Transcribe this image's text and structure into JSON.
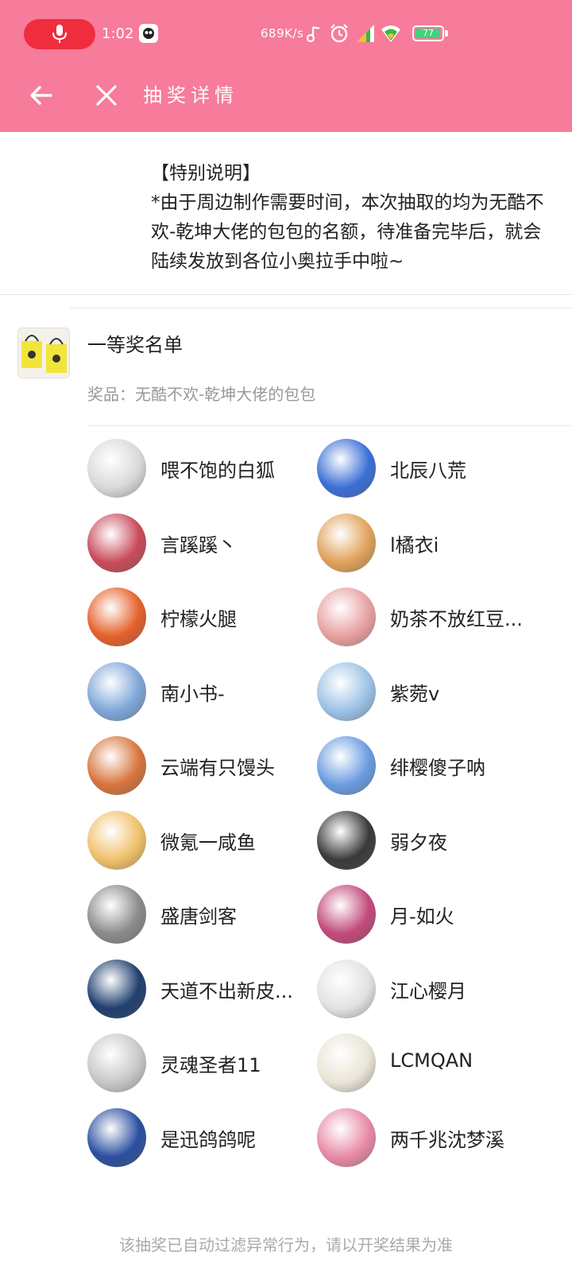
{
  "status_bar": {
    "time": "1:02",
    "net_speed": "689K/s",
    "battery": "77",
    "icons": [
      "mic-icon",
      "app-notification-icon",
      "music-icon",
      "alarm-icon",
      "signal-icon",
      "wifi-icon",
      "battery-icon"
    ]
  },
  "header": {
    "title": "抽奖详情",
    "back_icon": "arrow-left-icon",
    "close_icon": "close-icon"
  },
  "note": {
    "heading": "【特别说明】",
    "body": "*由于周边制作需要时间，本次抽取的均为无酷不欢-乾坤大佬的包包的名额，待准备完毕后，就会陆续发放到各位小奥拉手中啦~"
  },
  "prize": {
    "title": "一等奖名单",
    "label": "奖品：",
    "item": "无酷不欢-乾坤大佬的包包"
  },
  "winners": [
    {
      "name": "喂不饱的白狐",
      "color": "#d9d9d9"
    },
    {
      "name": "北辰八荒",
      "color": "#3b6fd6"
    },
    {
      "name": "言蹊蹊丶",
      "color": "#c94b5a"
    },
    {
      "name": "l橘衣i",
      "color": "#e0a25a"
    },
    {
      "name": "柠檬火腿",
      "color": "#e5602a"
    },
    {
      "name": "奶茶不放红豆...",
      "color": "#e8a0a0"
    },
    {
      "name": "南小书-",
      "color": "#7ea6d8"
    },
    {
      "name": "紫菀v",
      "color": "#9cc2e6"
    },
    {
      "name": "云端有只馒头",
      "color": "#d8743c"
    },
    {
      "name": "绯樱傻子呐",
      "color": "#6a9ce0"
    },
    {
      "name": "微氪一咸鱼",
      "color": "#f0c06a"
    },
    {
      "name": "弱夕夜",
      "color": "#3a3a3a"
    },
    {
      "name": "盛唐剑客",
      "color": "#8b8b8b"
    },
    {
      "name": "月-如火",
      "color": "#c24a7a"
    },
    {
      "name": "天道不出新皮...",
      "color": "#1f3f6e"
    },
    {
      "name": "江心樱月",
      "color": "#e2e2e2"
    },
    {
      "name": "灵魂圣者11",
      "color": "#c8c8c8"
    },
    {
      "name": "LCMQAN",
      "color": "#e9e4d6"
    },
    {
      "name": "是迅鸽鸽呢",
      "color": "#2a4fa0"
    },
    {
      "name": "两千兆沈梦溪",
      "color": "#e88aa6"
    }
  ],
  "footer": "该抽奖已自动过滤异常行为，请以开奖结果为准",
  "colors": {
    "accent": "#f77b9a",
    "mic_pill": "#f02c3f"
  }
}
